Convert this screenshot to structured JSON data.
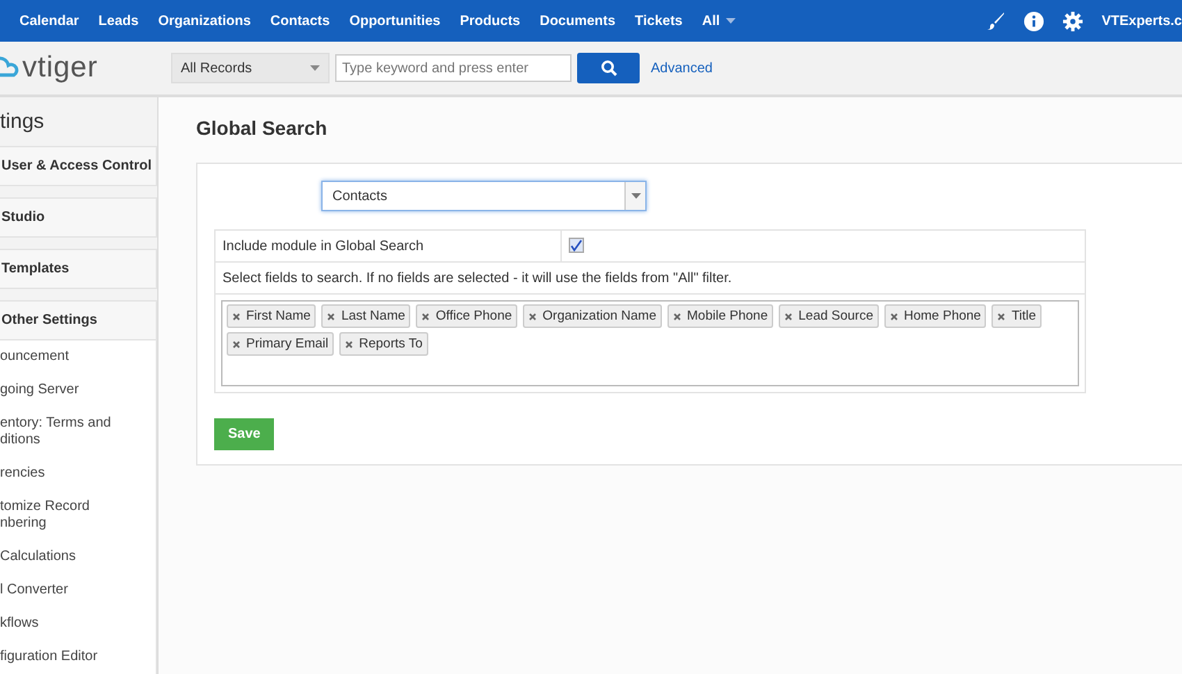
{
  "top_nav": {
    "items": [
      {
        "label": "Calendar",
        "dropdown": false
      },
      {
        "label": "Leads",
        "dropdown": false
      },
      {
        "label": "Organizations",
        "dropdown": false
      },
      {
        "label": "Contacts",
        "dropdown": false
      },
      {
        "label": "Opportunities",
        "dropdown": false
      },
      {
        "label": "Products",
        "dropdown": false
      },
      {
        "label": "Documents",
        "dropdown": false
      },
      {
        "label": "Tickets",
        "dropdown": false
      },
      {
        "label": "All",
        "dropdown": true
      }
    ],
    "user": "VTExperts.c"
  },
  "search_bar": {
    "logo": "vtiger",
    "scope": "All Records",
    "placeholder": "Type keyword and press enter",
    "advanced": "Advanced"
  },
  "sidebar": {
    "title": "tings",
    "groups": [
      {
        "label": "User & Access Control",
        "expanded": false
      },
      {
        "label": "Studio",
        "expanded": false
      },
      {
        "label": "Templates",
        "expanded": false
      },
      {
        "label": "Other Settings",
        "expanded": true
      }
    ],
    "items": [
      {
        "lines": [
          "ouncement"
        ]
      },
      {
        "lines": [
          "going Server"
        ]
      },
      {
        "lines": [
          "entory: Terms and",
          "ditions"
        ]
      },
      {
        "lines": [
          "rencies"
        ]
      },
      {
        "lines": [
          "tomize Record",
          "nbering"
        ]
      },
      {
        "lines": [
          "Calculations"
        ]
      },
      {
        "lines": [
          "l Converter"
        ]
      },
      {
        "lines": [
          "kflows"
        ]
      },
      {
        "lines": [
          "figuration Editor"
        ]
      }
    ]
  },
  "page": {
    "title": "Global Search",
    "module": "Contacts",
    "include_label": "Include module in Global Search",
    "include_checked": true,
    "fields_hint": "Select fields to search. If no fields are selected - it will use the fields from \"All\" filter.",
    "fields": [
      "First Name",
      "Last Name",
      "Office Phone",
      "Organization Name",
      "Mobile Phone",
      "Lead Source",
      "Home Phone",
      "Title",
      "Primary Email",
      "Reports To"
    ],
    "save": "Save"
  }
}
